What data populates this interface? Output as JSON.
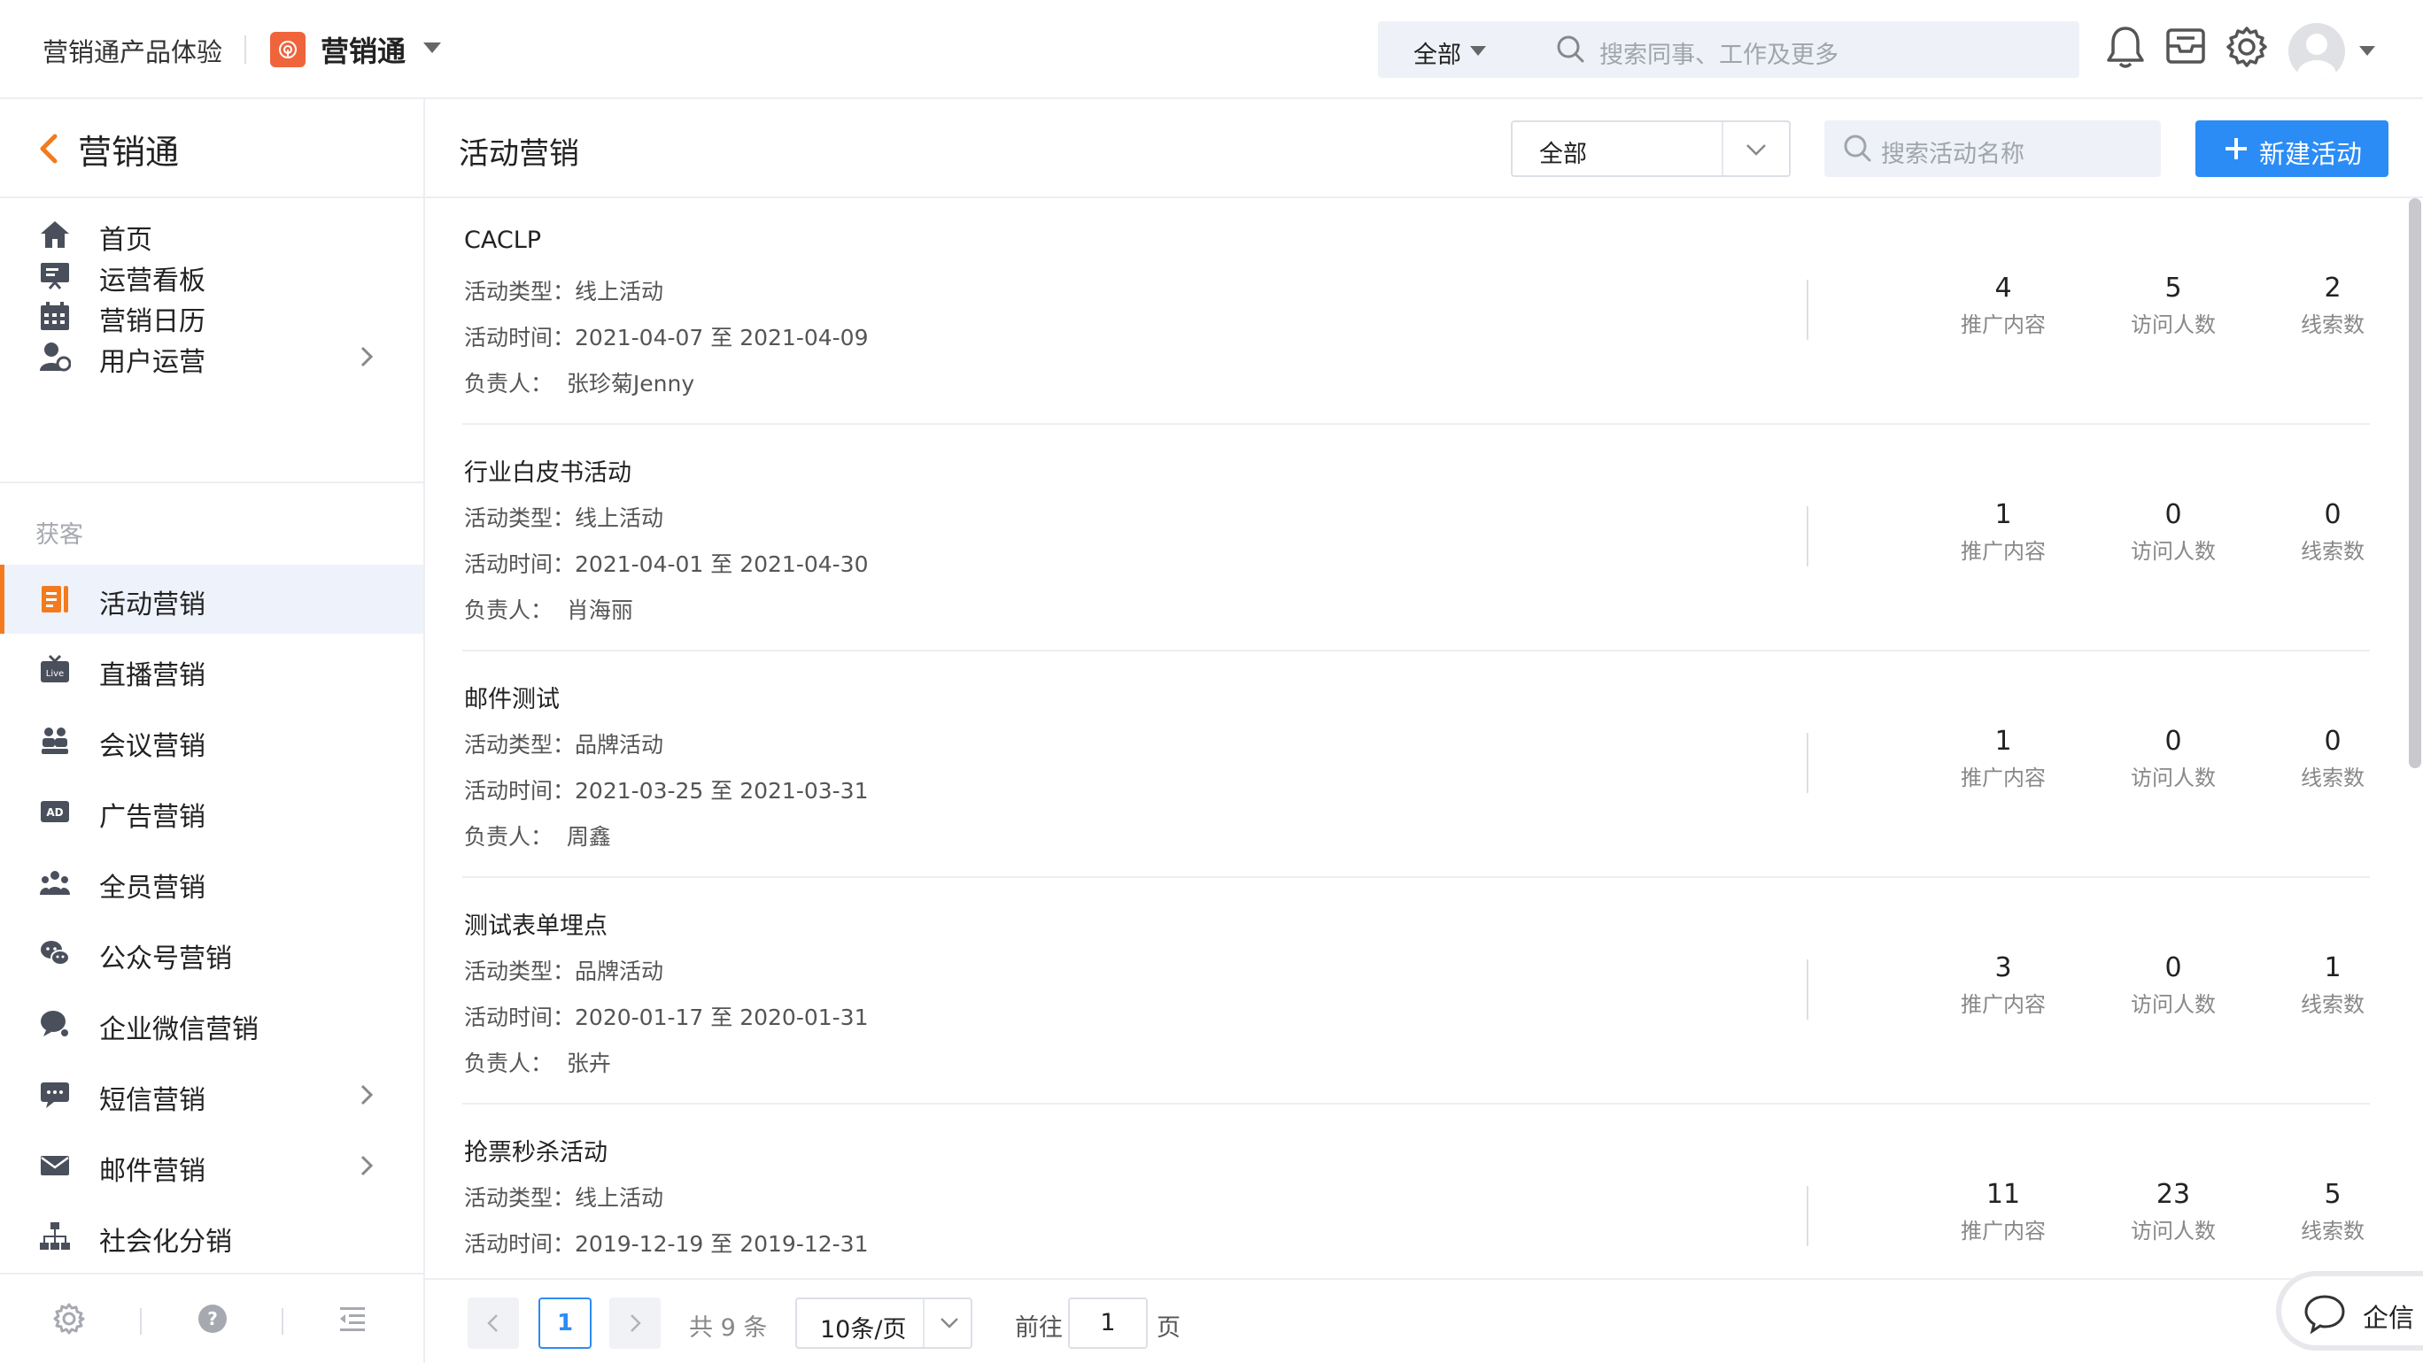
{
  "header": {
    "org_name": "营销通产品体验",
    "brand_name": "营销通",
    "search_scope": "全部",
    "search_placeholder": "搜索同事、工作及更多"
  },
  "sidebar": {
    "title": "营销通",
    "group_label": "获客",
    "items": [
      {
        "label": "首页",
        "icon": "home-icon"
      },
      {
        "label": "运营看板",
        "icon": "dashboard-icon"
      },
      {
        "label": "营销日历",
        "icon": "calendar-icon"
      },
      {
        "label": "用户运营",
        "icon": "user-ops-icon",
        "has_children": true
      },
      {
        "label": "活动营销",
        "icon": "activity-icon",
        "active": true
      },
      {
        "label": "直播营销",
        "icon": "live-icon"
      },
      {
        "label": "会议营销",
        "icon": "meeting-icon"
      },
      {
        "label": "广告营销",
        "icon": "ad-icon"
      },
      {
        "label": "全员营销",
        "icon": "team-icon"
      },
      {
        "label": "公众号营销",
        "icon": "wechat-icon"
      },
      {
        "label": "企业微信营销",
        "icon": "wecom-icon"
      },
      {
        "label": "短信营销",
        "icon": "sms-icon",
        "has_children": true
      },
      {
        "label": "邮件营销",
        "icon": "mail-icon",
        "has_children": true
      },
      {
        "label": "社会化分销",
        "icon": "distribution-icon"
      }
    ]
  },
  "main": {
    "page_title": "活动营销",
    "filter_value": "全部",
    "search_placeholder": "搜索活动名称",
    "new_button": "新建活动",
    "labels": {
      "type": "活动类型：",
      "time": "活动时间：",
      "owner": "负责人：",
      "content": "推广内容",
      "visitors": "访问人数",
      "leads": "线索数"
    },
    "activities": [
      {
        "name": "CACLP",
        "type": "线上活动",
        "time": "2021-04-07 至 2021-04-09",
        "owner": "张珍菊Jenny",
        "content": "4",
        "visitors": "5",
        "leads": "2"
      },
      {
        "name": "行业白皮书活动",
        "type": "线上活动",
        "time": "2021-04-01 至 2021-04-30",
        "owner": "肖海丽",
        "content": "1",
        "visitors": "0",
        "leads": "0"
      },
      {
        "name": "邮件测试",
        "type": "品牌活动",
        "time": "2021-03-25 至 2021-03-31",
        "owner": "周鑫",
        "content": "1",
        "visitors": "0",
        "leads": "0"
      },
      {
        "name": "测试表单埋点",
        "type": "品牌活动",
        "time": "2020-01-17 至 2020-01-31",
        "owner": "张卉",
        "content": "3",
        "visitors": "0",
        "leads": "1"
      },
      {
        "name": "抢票秒杀活动",
        "type": "线上活动",
        "time": "2019-12-19 至 2019-12-31",
        "owner": "",
        "content": "11",
        "visitors": "23",
        "leads": "5"
      }
    ]
  },
  "pager": {
    "current": "1",
    "total": "共 9 条",
    "page_size": "10条/页",
    "goto": "前往",
    "goto_value": "1",
    "page_unit": "页"
  },
  "chat_widget": {
    "label": "企信"
  },
  "colors": {
    "accent": "#2b8cf6",
    "active_marker": "#f37b1d",
    "brand": "#f0643c"
  }
}
